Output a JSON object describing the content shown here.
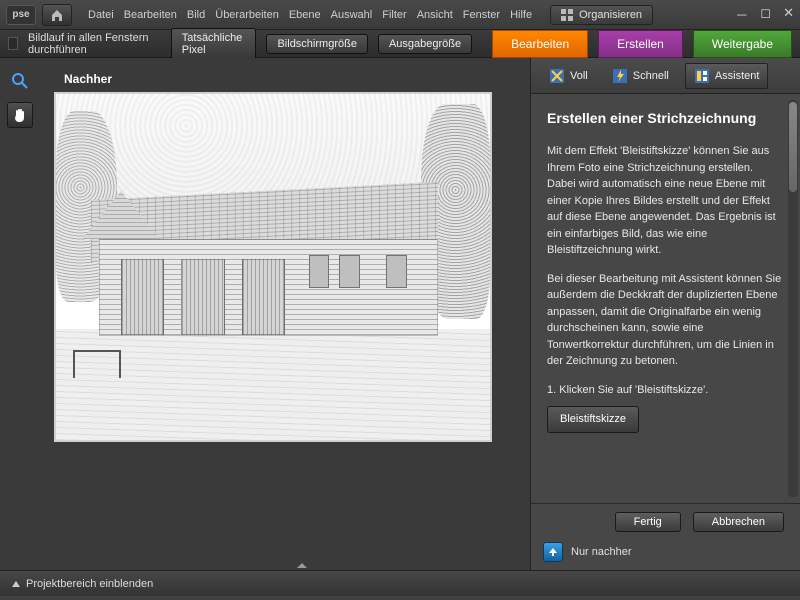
{
  "app": {
    "logo_text": "pse"
  },
  "menu": [
    "Datei",
    "Bearbeiten",
    "Bild",
    "Überarbeiten",
    "Ebene",
    "Auswahl",
    "Filter",
    "Ansicht",
    "Fenster",
    "Hilfe"
  ],
  "organize_label": "Organisieren",
  "options_bar": {
    "scroll_all_label": "Bildlauf in allen Fenstern durchführen",
    "buttons": [
      "Tatsächliche Pixel",
      "Bildschirmgröße",
      "Ausgabegröße"
    ]
  },
  "mode_tabs": {
    "edit": "Bearbeiten",
    "create": "Erstellen",
    "share": "Weitergabe"
  },
  "sub_tabs": {
    "full": "Voll",
    "quick": "Schnell",
    "guided": "Assistent"
  },
  "canvas": {
    "after_label": "Nachher"
  },
  "panel": {
    "title": "Erstellen einer Strichzeichnung",
    "p1": "Mit dem Effekt 'Bleistiftskizze' können Sie aus Ihrem Foto eine Strichzeichnung erstellen. Dabei wird automatisch eine neue Ebene mit einer Kopie Ihres Bildes erstellt und der Effekt auf diese Ebene angewendet. Das Ergebnis ist ein einfarbiges Bild, das wie eine Bleistiftzeichnung wirkt.",
    "p2": "Bei dieser Bearbeitung mit Assistent können Sie außerdem die Deckkraft der duplizierten Ebene anpassen, damit die Originalfarbe ein wenig durchscheinen kann, sowie eine Tonwertkorrektur durchführen, um die Linien in der Zeichnung zu betonen.",
    "step1": "1. Klicken Sie auf 'Bleistiftskizze'.",
    "effect_button": "Bleistiftskizze",
    "done": "Fertig",
    "cancel": "Abbrechen",
    "view_label": "Nur nachher"
  },
  "statusbar": {
    "expand_label": "Projektbereich einblenden"
  },
  "colors": {
    "accent_edit": "#ff7a00",
    "accent_create": "#a83eaa",
    "accent_share": "#4fa838"
  }
}
